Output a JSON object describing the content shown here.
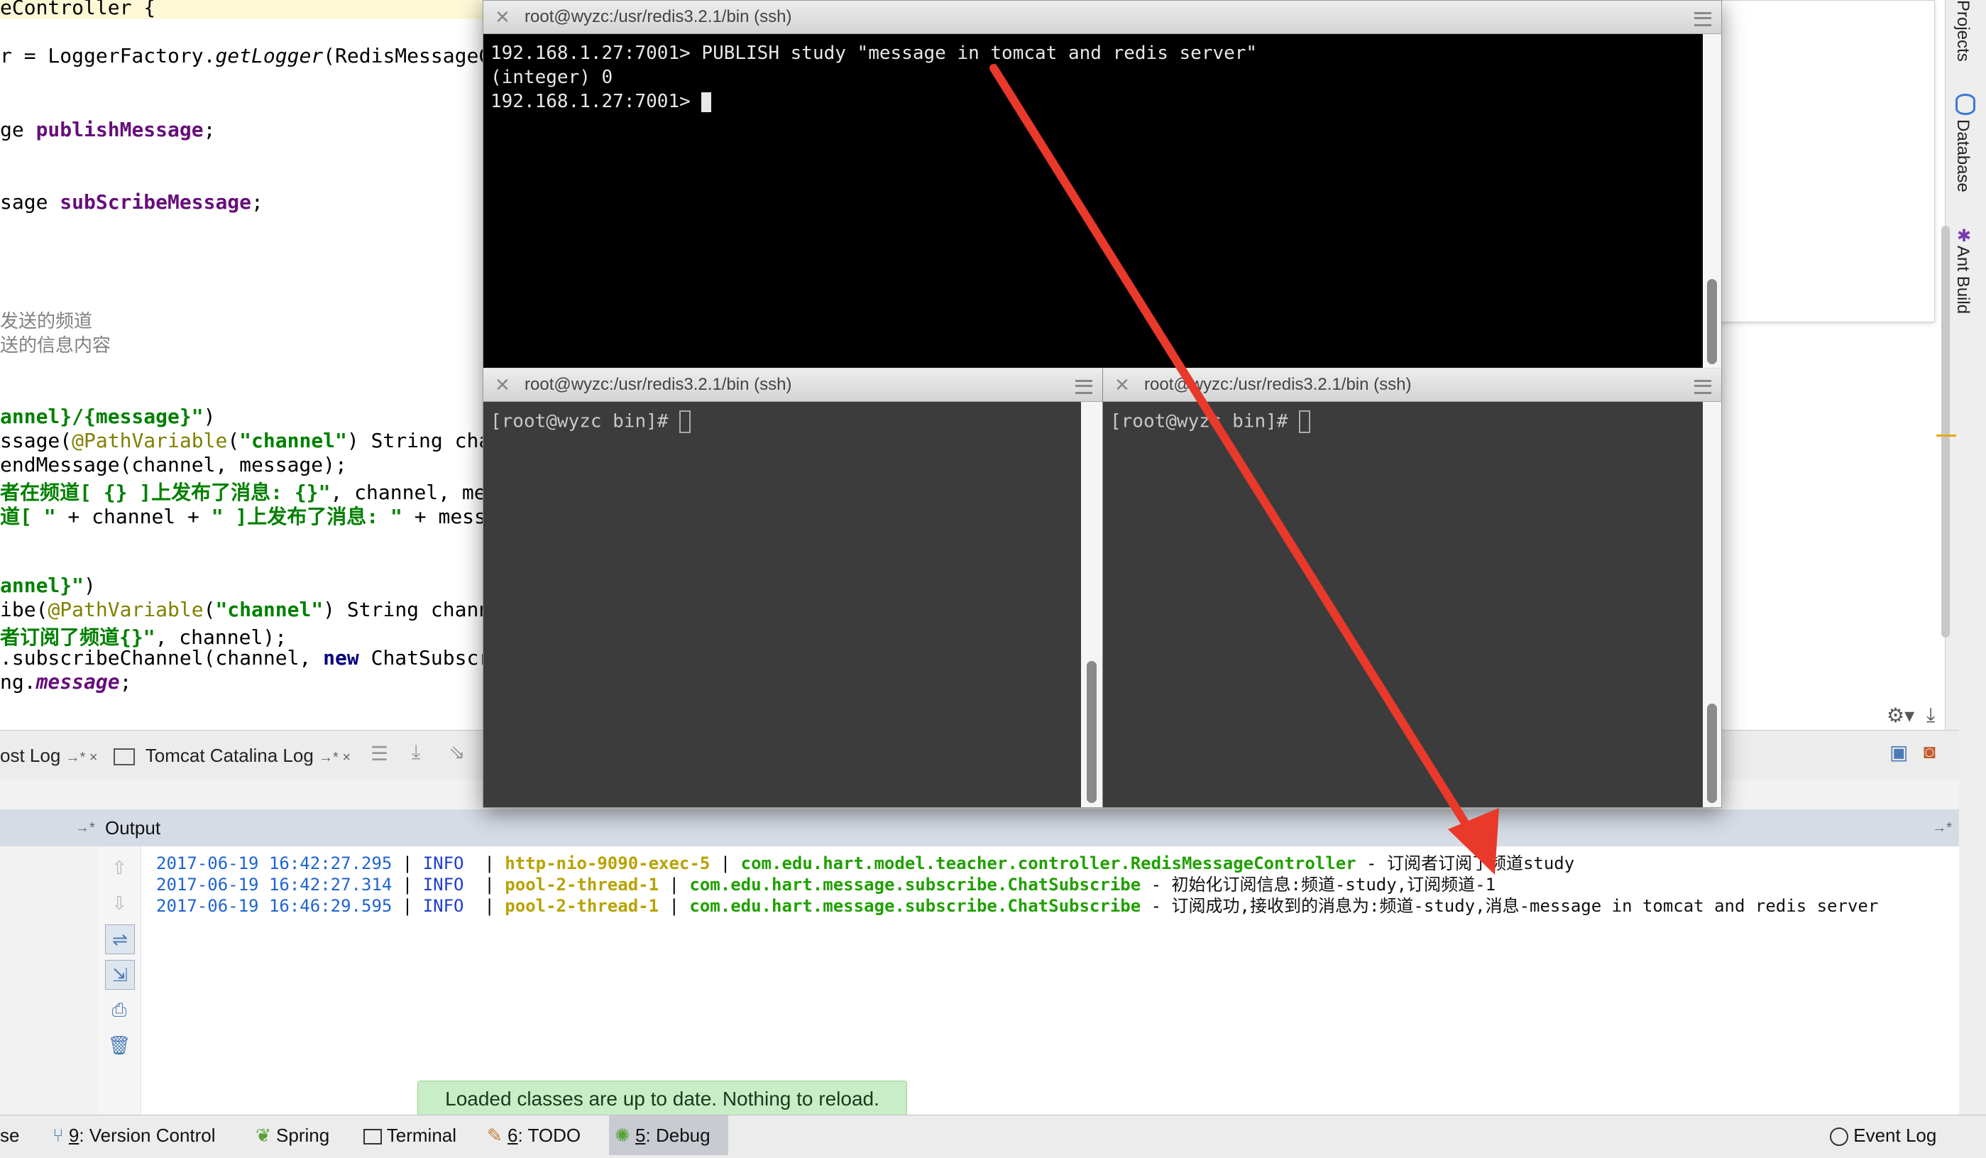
{
  "editor": {
    "lines": [
      {
        "segments": [
          {
            "t": "eController {",
            "c": ""
          }
        ]
      },
      {
        "segments": [
          {
            "t": "r = LoggerFactory.",
            "c": ""
          },
          {
            "t": "getLogger",
            "c": "it"
          },
          {
            "t": "(RedisMessageCon",
            "c": ""
          }
        ]
      },
      {
        "segments": [
          {
            "t": "ge ",
            "c": ""
          },
          {
            "t": "publishMessage",
            "c": "fld"
          },
          {
            "t": ";",
            "c": ""
          }
        ]
      },
      {
        "segments": [
          {
            "t": "sage ",
            "c": ""
          },
          {
            "t": "subScribeMessage",
            "c": "fld"
          },
          {
            "t": ";",
            "c": ""
          }
        ]
      },
      {
        "segments": [
          {
            "t": "发送的频道",
            "c": "cmt"
          }
        ]
      },
      {
        "segments": [
          {
            "t": "送的信息内容",
            "c": "cmt"
          }
        ]
      },
      {
        "segments": [
          {
            "t": "annel}/{message}\"",
            "c": "str"
          },
          {
            "t": ")",
            "c": ""
          }
        ]
      },
      {
        "segments": [
          {
            "t": "ssage(",
            "c": ""
          },
          {
            "t": "@PathVariable",
            "c": "ann"
          },
          {
            "t": "(",
            "c": ""
          },
          {
            "t": "\"channel\"",
            "c": "str"
          },
          {
            "t": ") String chann",
            "c": ""
          }
        ]
      },
      {
        "segments": [
          {
            "t": "endMessage(channel, message);",
            "c": ""
          }
        ]
      },
      {
        "segments": [
          {
            "t": "者在频道[ {} ]上发布了消息: {}\"",
            "c": "str"
          },
          {
            "t": ", channel, messa",
            "c": ""
          }
        ]
      },
      {
        "segments": [
          {
            "t": "道[ \"",
            "c": "str"
          },
          {
            "t": " + channel + ",
            "c": ""
          },
          {
            "t": "\" ]上发布了消息: \"",
            "c": "str"
          },
          {
            "t": " + message",
            "c": ""
          }
        ]
      },
      {
        "segments": [
          {
            "t": "annel}\"",
            "c": "str"
          },
          {
            "t": ")",
            "c": ""
          }
        ]
      },
      {
        "segments": [
          {
            "t": "ibe(",
            "c": ""
          },
          {
            "t": "@PathVariable",
            "c": "ann"
          },
          {
            "t": "(",
            "c": ""
          },
          {
            "t": "\"channel\"",
            "c": "str"
          },
          {
            "t": ") String channel",
            "c": ""
          }
        ]
      },
      {
        "segments": [
          {
            "t": "者订阅了频道{}\"",
            "c": "str"
          },
          {
            "t": ", channel);",
            "c": ""
          }
        ]
      },
      {
        "segments": [
          {
            "t": ".subscribeChannel(channel, ",
            "c": ""
          },
          {
            "t": "new",
            "c": "kw"
          },
          {
            "t": " ChatSubscrib",
            "c": ""
          }
        ]
      },
      {
        "segments": [
          {
            "t": "ng.",
            "c": ""
          },
          {
            "t": "message",
            "c": "fld it"
          },
          {
            "t": ";",
            "c": ""
          }
        ]
      }
    ]
  },
  "rightStripe": {
    "tabs": [
      "Projects",
      "Database",
      "Ant Build"
    ]
  },
  "debugToolbar": {
    "tabs": [
      {
        "label": "ost Log",
        "suffix": "→* ×"
      },
      {
        "label": "Tomcat Catalina Log",
        "suffix": "→* ×"
      }
    ]
  },
  "output": {
    "label": "Output",
    "logs": [
      {
        "date": "2017-06-19",
        "time": "16:42:27.295",
        "level": "INFO",
        "thread": "http-nio-9090-exec-5",
        "cls": "com.edu.hart.model.teacher.controller.RedisMessageController",
        "msg": "订阅者订阅了频道study"
      },
      {
        "date": "2017-06-19",
        "time": "16:42:27.314",
        "level": "INFO",
        "thread": "pool-2-thread-1",
        "cls": "com.edu.hart.message.subscribe.ChatSubscribe",
        "msg": "初始化订阅信息:频道-study,订阅频道-1"
      },
      {
        "date": "2017-06-19",
        "time": "16:46:29.595",
        "level": "INFO",
        "thread": "pool-2-thread-1",
        "cls": "com.edu.hart.message.subscribe.ChatSubscribe",
        "msg": "订阅成功,接收到的消息为:频道-study,消息-message in tomcat and redis server"
      }
    ]
  },
  "toast": "Loaded classes are up to date. Nothing to reload.",
  "statusBar": {
    "items": [
      {
        "label": "se",
        "key": ""
      },
      {
        "label": "Version Control",
        "key": "9"
      },
      {
        "label": "Spring",
        "key": ""
      },
      {
        "label": "Terminal",
        "key": ""
      },
      {
        "label": "TODO",
        "key": "6"
      },
      {
        "label": "Debug",
        "key": "5"
      }
    ],
    "eventLog": "Event Log"
  },
  "terminals": {
    "top": {
      "title": "root@wyzc:/usr/redis3.2.1/bin (ssh)",
      "lines": [
        "192.168.1.27:7001> PUBLISH study \"message in tomcat and redis server\"",
        "(integer) 0",
        "192.168.1.27:7001> "
      ]
    },
    "bottomLeft": {
      "title": "root@wyzc:/usr/redis3.2.1/bin (ssh)",
      "lines": [
        "[root@wyzc bin]# "
      ]
    },
    "bottomRight": {
      "title": "root@wyzc:/usr/redis3.2.1/bin (ssh)",
      "lines": [
        "[root@wyzc bin]# "
      ]
    }
  },
  "colors": {
    "arrow": "#e8392a",
    "terminalTop": "#000000",
    "terminalBottom": "#3c3c3c"
  }
}
